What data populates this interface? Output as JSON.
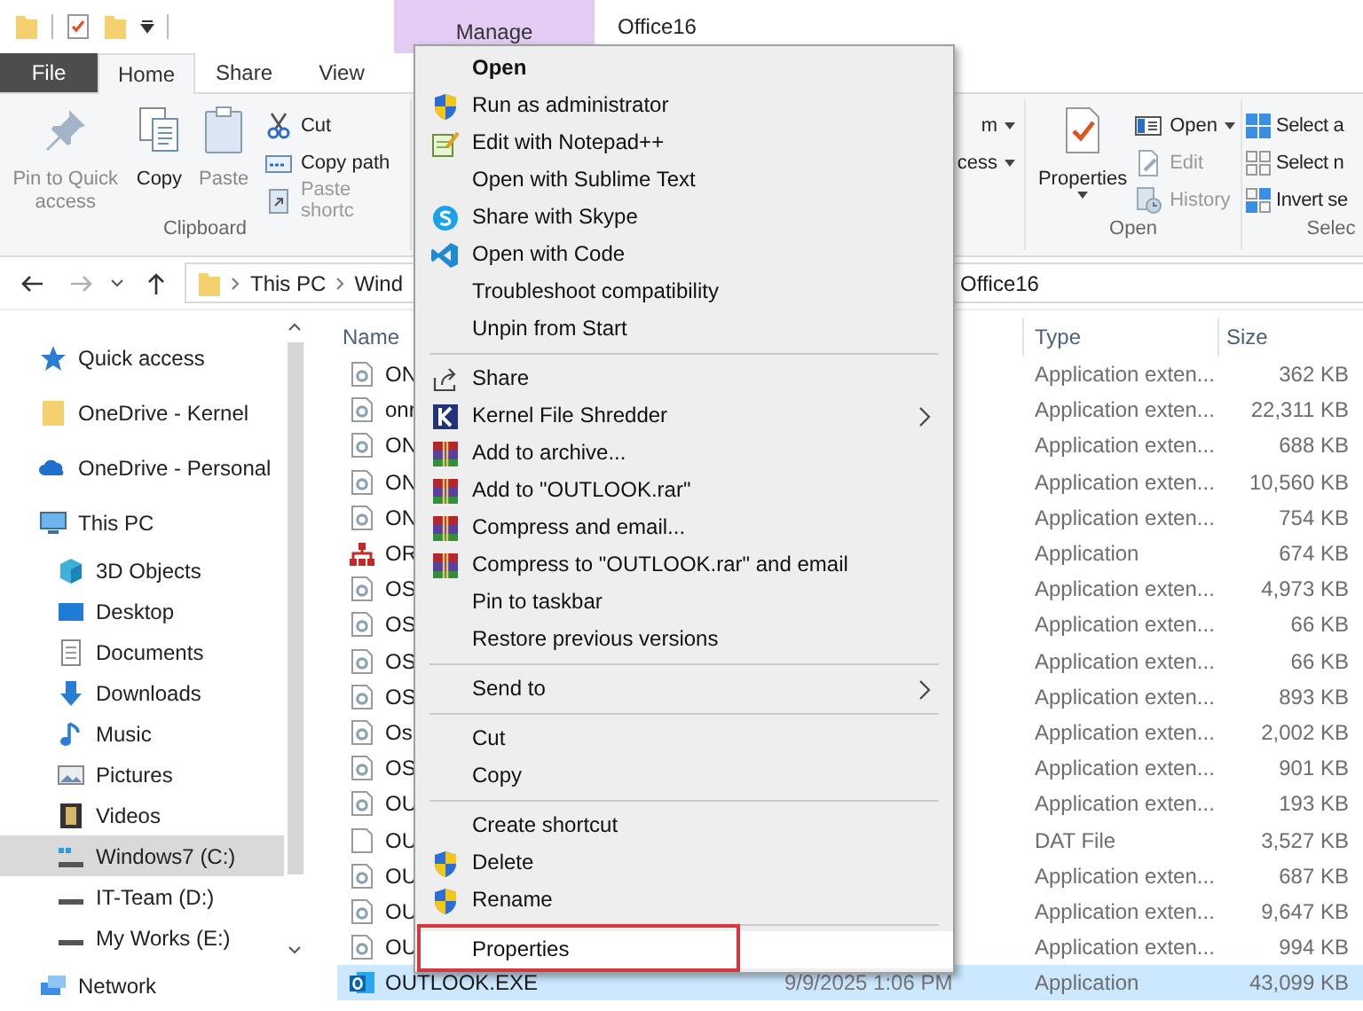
{
  "title_bar": {
    "context_tab": "Manage",
    "title": "Office16"
  },
  "ribbon_tabs": [
    {
      "label": "File",
      "kind": "file",
      "selected": false
    },
    {
      "label": "Home",
      "kind": "tab",
      "selected": true
    },
    {
      "label": "Share",
      "kind": "tab",
      "selected": false
    },
    {
      "label": "View",
      "kind": "tab",
      "selected": false
    }
  ],
  "clipboard_group": {
    "label": "Clipboard",
    "large_buttons": [
      {
        "label": "Pin to Quick access",
        "disabled": true
      },
      {
        "label": "Copy",
        "disabled": false
      },
      {
        "label": "Paste",
        "disabled": true
      }
    ],
    "small_buttons": [
      {
        "label": "Cut",
        "disabled": false
      },
      {
        "label": "Copy path",
        "disabled": false
      },
      {
        "label": "Paste shortc",
        "disabled": true
      }
    ]
  },
  "organize_group_partial": {
    "buttons": [
      {
        "label": "m"
      },
      {
        "label": "cess"
      }
    ]
  },
  "open_group": {
    "label": "Open",
    "large_button": {
      "label": "Properties"
    },
    "small_buttons": [
      {
        "label": "Open",
        "disabled": false
      },
      {
        "label": "Edit",
        "disabled": true
      },
      {
        "label": "History",
        "disabled": true
      }
    ]
  },
  "select_group": {
    "label": "Selec",
    "small_buttons": [
      {
        "label": "Select a"
      },
      {
        "label": "Select n"
      },
      {
        "label": "Invert se"
      }
    ]
  },
  "address_bar": {
    "path": [
      "This PC",
      "Wind"
    ],
    "path_tail": "Office16"
  },
  "sidebar": {
    "items": [
      {
        "label": "Quick access",
        "kind": "star",
        "selected": false
      },
      {
        "label": "OneDrive - Kernel",
        "kind": "folder",
        "selected": false
      },
      {
        "label": "OneDrive - Personal",
        "kind": "cloud",
        "selected": false
      },
      {
        "label": "This PC",
        "kind": "pc",
        "selected": false,
        "children": [
          {
            "label": "3D Objects",
            "kind": "cube",
            "selected": false
          },
          {
            "label": "Desktop",
            "kind": "desktop",
            "selected": false
          },
          {
            "label": "Documents",
            "kind": "documents",
            "selected": false
          },
          {
            "label": "Downloads",
            "kind": "downloads",
            "selected": false
          },
          {
            "label": "Music",
            "kind": "music",
            "selected": false
          },
          {
            "label": "Pictures",
            "kind": "pictures",
            "selected": false
          },
          {
            "label": "Videos",
            "kind": "videos",
            "selected": false
          },
          {
            "label": "Windows7 (C:)",
            "kind": "system-drive",
            "selected": true
          },
          {
            "label": "IT-Team (D:)",
            "kind": "drive",
            "selected": false
          },
          {
            "label": "My Works (E:)",
            "kind": "drive",
            "selected": false
          }
        ]
      },
      {
        "label": "Network",
        "kind": "network",
        "selected": false
      }
    ]
  },
  "file_list": {
    "columns": [
      "Name",
      "Type",
      "Size"
    ],
    "rows": [
      {
        "name": "ON",
        "type": "Application exten...",
        "size": "362 KB",
        "kind": "dll",
        "selected": false
      },
      {
        "name": "onr",
        "type": "Application exten...",
        "size": "22,311 KB",
        "kind": "dll",
        "selected": false
      },
      {
        "name": "ON",
        "type": "Application exten...",
        "size": "688 KB",
        "kind": "dll",
        "selected": false
      },
      {
        "name": "ON",
        "type": "Application exten...",
        "size": "10,560 KB",
        "kind": "dll",
        "selected": false
      },
      {
        "name": "ON",
        "type": "Application exten...",
        "size": "754 KB",
        "kind": "dll",
        "selected": false
      },
      {
        "name": "OR",
        "type": "Application",
        "size": "674 KB",
        "kind": "org",
        "selected": false
      },
      {
        "name": "OS",
        "type": "Application exten...",
        "size": "4,973 KB",
        "kind": "dll",
        "selected": false
      },
      {
        "name": "OS",
        "type": "Application exten...",
        "size": "66 KB",
        "kind": "dll",
        "selected": false
      },
      {
        "name": "OS",
        "type": "Application exten...",
        "size": "66 KB",
        "kind": "dll",
        "selected": false
      },
      {
        "name": "OS",
        "type": "Application exten...",
        "size": "893 KB",
        "kind": "dll",
        "selected": false
      },
      {
        "name": "Os",
        "type": "Application exten...",
        "size": "2,002 KB",
        "kind": "dll",
        "selected": false
      },
      {
        "name": "OS",
        "type": "Application exten...",
        "size": "901 KB",
        "kind": "dll",
        "selected": false
      },
      {
        "name": "OU",
        "type": "Application exten...",
        "size": "193 KB",
        "kind": "dll",
        "selected": false
      },
      {
        "name": "OU",
        "type": "DAT File",
        "size": "3,527 KB",
        "kind": "file",
        "selected": false
      },
      {
        "name": "OU",
        "type": "Application exten...",
        "size": "687 KB",
        "kind": "dll",
        "selected": false
      },
      {
        "name": "OU",
        "type": "Application exten...",
        "size": "9,647 KB",
        "kind": "dll",
        "selected": false
      },
      {
        "name": "OU",
        "type": "Application exten...",
        "size": "994 KB",
        "kind": "dll",
        "selected": false
      },
      {
        "name": "OUTLOOK.EXE",
        "date": "9/9/2025 1:06 PM",
        "type": "Application",
        "size": "43,099 KB",
        "kind": "mail-app",
        "selected": true
      }
    ]
  },
  "context_menu": {
    "items": [
      {
        "label": "Open",
        "kind": "default",
        "submenu": false,
        "selected": false
      },
      {
        "label": "Run as administrator",
        "kind": "shield",
        "submenu": false,
        "selected": false
      },
      {
        "label": "Edit with Notepad++",
        "kind": "notepad",
        "submenu": false,
        "selected": false
      },
      {
        "label": "Open with Sublime Text",
        "kind": "plain",
        "submenu": false,
        "selected": false
      },
      {
        "label": "Share with Skype",
        "kind": "skype",
        "submenu": false,
        "selected": false
      },
      {
        "label": "Open with Code",
        "kind": "code",
        "submenu": false,
        "selected": false
      },
      {
        "label": "Troubleshoot compatibility",
        "kind": "plain",
        "submenu": false,
        "selected": false
      },
      {
        "label": "Unpin from Start",
        "kind": "plain",
        "submenu": false,
        "selected": false
      },
      {
        "kind": "separator"
      },
      {
        "label": "Share",
        "kind": "share",
        "submenu": false,
        "selected": false
      },
      {
        "label": "Kernel File Shredder",
        "kind": "shredder",
        "submenu": true,
        "selected": false
      },
      {
        "label": "Add to archive...",
        "kind": "archive",
        "submenu": false,
        "selected": false
      },
      {
        "label": "Add to \"OUTLOOK.rar\"",
        "kind": "archive",
        "submenu": false,
        "selected": false
      },
      {
        "label": "Compress and email...",
        "kind": "archive",
        "submenu": false,
        "selected": false
      },
      {
        "label": "Compress to \"OUTLOOK.rar\" and email",
        "kind": "archive",
        "submenu": false,
        "selected": false
      },
      {
        "label": "Pin to taskbar",
        "kind": "plain",
        "submenu": false,
        "selected": false
      },
      {
        "label": "Restore previous versions",
        "kind": "plain",
        "submenu": false,
        "selected": false
      },
      {
        "kind": "separator"
      },
      {
        "label": "Send to",
        "kind": "plain",
        "submenu": true,
        "selected": false
      },
      {
        "kind": "separator"
      },
      {
        "label": "Cut",
        "kind": "plain",
        "submenu": false,
        "selected": false
      },
      {
        "label": "Copy",
        "kind": "plain",
        "submenu": false,
        "selected": false
      },
      {
        "kind": "separator"
      },
      {
        "label": "Create shortcut",
        "kind": "plain",
        "submenu": false,
        "selected": false
      },
      {
        "label": "Delete",
        "kind": "shield",
        "submenu": false,
        "selected": false
      },
      {
        "label": "Rename",
        "kind": "shield",
        "submenu": false,
        "selected": false
      },
      {
        "kind": "separator"
      },
      {
        "label": "Properties",
        "kind": "plain",
        "submenu": false,
        "selected": true
      }
    ]
  }
}
